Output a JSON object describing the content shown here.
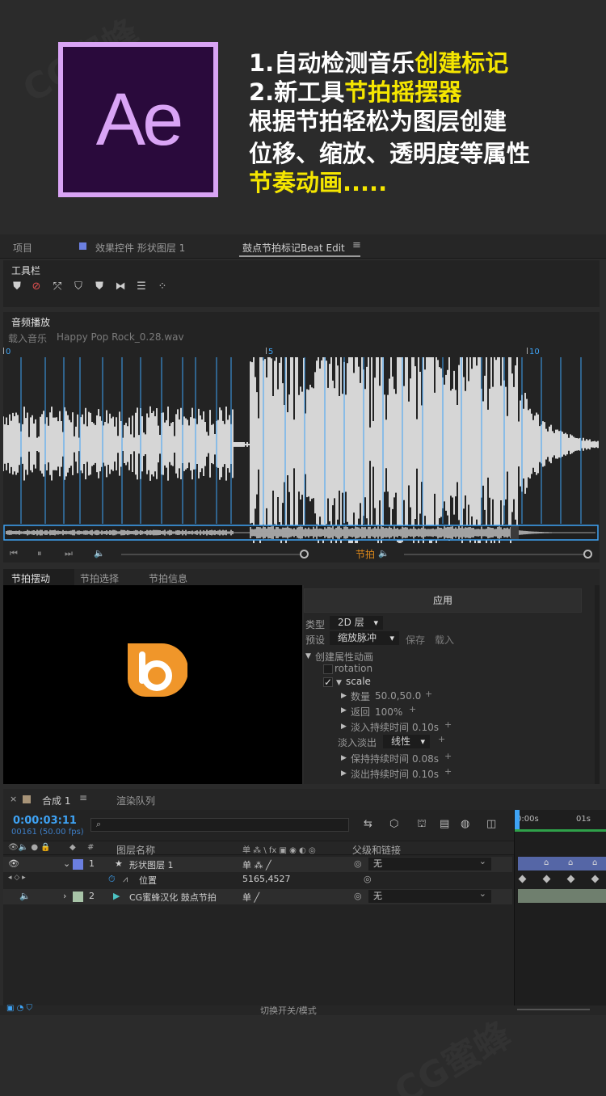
{
  "banner": {
    "logo_text": "Ae",
    "line1_prefix": "1.自动检测音乐",
    "line1_highlight": "创建标记",
    "line2_prefix": "2.新工具",
    "line2_highlight": "节拍摇摆器",
    "line3": "根据节拍轻松为图层创建",
    "line4": "位移、缩放、透明度等属性",
    "line5_highlight": "节奏动画....."
  },
  "tabs": {
    "project": "项目",
    "effects": "效果控件 形状图层 1",
    "beat_edit": "鼓点节拍标记Beat Edit",
    "menu_icon": "≡"
  },
  "toolbar": {
    "title": "工具栏"
  },
  "audio": {
    "title": "音频播放",
    "load_label": "载入音乐",
    "file_name": "Happy Pop Rock_0.28.wav",
    "ruler_labels": [
      "0",
      "5",
      "10"
    ],
    "beat_label": "节拍"
  },
  "beat_tabs": {
    "wiggle": "节拍摆动",
    "select": "节拍选择",
    "info": "节拍信息"
  },
  "beat_props": {
    "apply": "应用",
    "type_label": "类型",
    "type_value": "2D 层",
    "preset_label": "预设",
    "preset_value": "缩放脉冲",
    "save": "保存",
    "load": "载入",
    "create_anim": "创建属性动画",
    "rotation": "rotation",
    "scale": "scale",
    "amount_label": "数量",
    "amount_value": "50.0,50.0",
    "return_label": "返回",
    "return_value": "100%",
    "fade_in_dur_label": "淡入持续时间",
    "fade_in_dur_value": "0.10s",
    "fade_label": "淡入淡出",
    "fade_value": "线性",
    "hold_dur_label": "保持持续时间",
    "hold_dur_value": "0.08s",
    "fade_out_dur_label": "淡出持续时间",
    "fade_out_dur_value": "0.10s"
  },
  "comp": {
    "tab_name": "合成 1",
    "render_queue": "渲染队列",
    "timecode": "0:00:03:11",
    "frames": "00161 (50.00 fps)",
    "search_placeholder": "",
    "col_layer_name": "图层名称",
    "col_parent": "父级和链接",
    "col_switches": "单 ⁂ \\ fx ▣ ◉ ◐ ◎",
    "ruler_0": "0:00s",
    "ruler_1": "01s",
    "layers": [
      {
        "num": "1",
        "name": "形状图层 1",
        "parent": "无",
        "color": "#6b7fe0"
      },
      {
        "num": "2",
        "name": "CG蜜蜂汉化 鼓点节拍",
        "parent": "无",
        "color": "#a8c4a8"
      }
    ],
    "position_label": "位置",
    "position_value": "5165,4527",
    "switch_modes": "切换开关/模式"
  },
  "colors": {
    "accent_blue": "#3ea3f5",
    "highlight_yellow": "#f5e600",
    "beat_orange": "#e08a1a",
    "logo_orange": "#f0962a"
  }
}
